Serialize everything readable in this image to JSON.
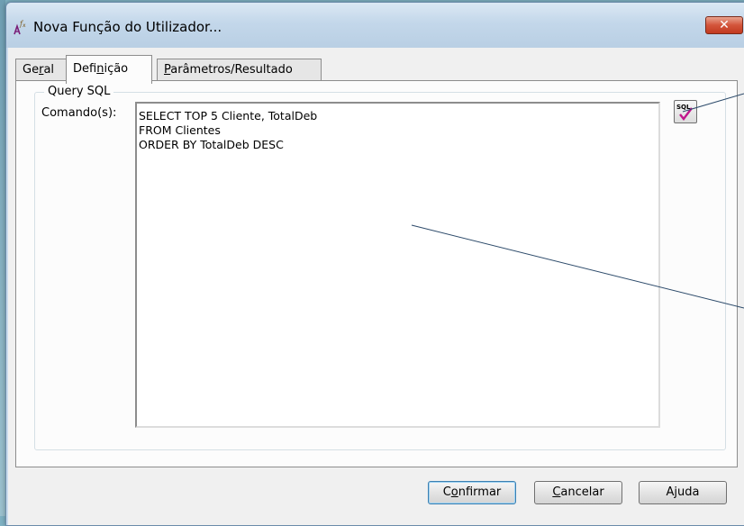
{
  "window": {
    "title": "Nova Função do Utilizador...",
    "close_label": "✕"
  },
  "tabs": [
    {
      "pre": "Ge",
      "u": "r",
      "post": "al",
      "active": false
    },
    {
      "pre": "Defi",
      "u": "n",
      "post": "ição",
      "active": true
    },
    {
      "pre": "",
      "u": "P",
      "post": "arâmetros/Resultado",
      "active": false
    }
  ],
  "group": {
    "legend": "Query SQL",
    "command_label": "Comando(s):",
    "sql_text": "SELECT TOP 5 Cliente, TotalDeb\nFROM Clientes\nORDER BY TotalDeb DESC",
    "sql_button_icon": "sql-check-icon",
    "sql_button_icon_text": "SQL"
  },
  "buttons": {
    "confirm": {
      "pre": "C",
      "u": "o",
      "post": "nfirmar"
    },
    "cancel": {
      "pre": "",
      "u": "C",
      "post": "ancelar"
    },
    "help": {
      "pre": "A",
      "u": "j",
      "post": "uda"
    }
  },
  "colors": {
    "accent": "#3c7fb1",
    "close_button": "#c9432a",
    "annotation_line": "#2c4a6a"
  }
}
